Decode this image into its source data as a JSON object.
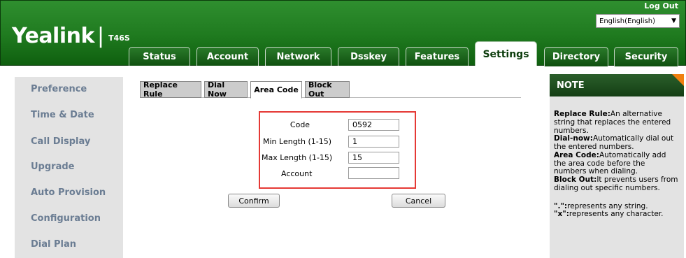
{
  "header": {
    "brand": "Yealink",
    "model": "T46S",
    "logout": "Log Out",
    "language": "English(English)"
  },
  "tabs": [
    {
      "label": "Status"
    },
    {
      "label": "Account"
    },
    {
      "label": "Network"
    },
    {
      "label": "Dsskey"
    },
    {
      "label": "Features"
    },
    {
      "label": "Settings"
    },
    {
      "label": "Directory"
    },
    {
      "label": "Security"
    }
  ],
  "sidebar": {
    "items": [
      {
        "label": "Preference"
      },
      {
        "label": "Time & Date"
      },
      {
        "label": "Call Display"
      },
      {
        "label": "Upgrade"
      },
      {
        "label": "Auto Provision"
      },
      {
        "label": "Configuration"
      },
      {
        "label": "Dial Plan"
      }
    ]
  },
  "subtabs": [
    {
      "label": "Replace Rule"
    },
    {
      "label": "Dial Now"
    },
    {
      "label": "Area Code"
    },
    {
      "label": "Block Out"
    }
  ],
  "form": {
    "code_label": "Code",
    "code_value": "0592",
    "min_label": "Min Length (1-15)",
    "min_value": "1",
    "max_label": "Max Length (1-15)",
    "max_value": "15",
    "account_label": "Account",
    "account_value": "",
    "confirm": "Confirm",
    "cancel": "Cancel"
  },
  "note": {
    "title": "NOTE",
    "replace_title": "Replace Rule:",
    "replace_text": "An alternative string that replaces the entered numbers.",
    "dialnow_title": "Dial-now:",
    "dialnow_text": "Automatically dial out the entered numbers.",
    "areacode_title": "Area Code:",
    "areacode_text": "Automatically add the area code before the numbers when dialing.",
    "blockout_title": "Block Out:",
    "blockout_text": "It prevents users from dialing out specific numbers.",
    "dot_title": "\".\":",
    "dot_text": "represents any string.",
    "x_title": "\"x\":",
    "x_text": "represents any character."
  },
  "colors": {
    "header_green": "#1f7a1f",
    "sidebar_text": "#6b7d93",
    "highlight_red": "#e53935",
    "note_orange": "#f08010"
  }
}
